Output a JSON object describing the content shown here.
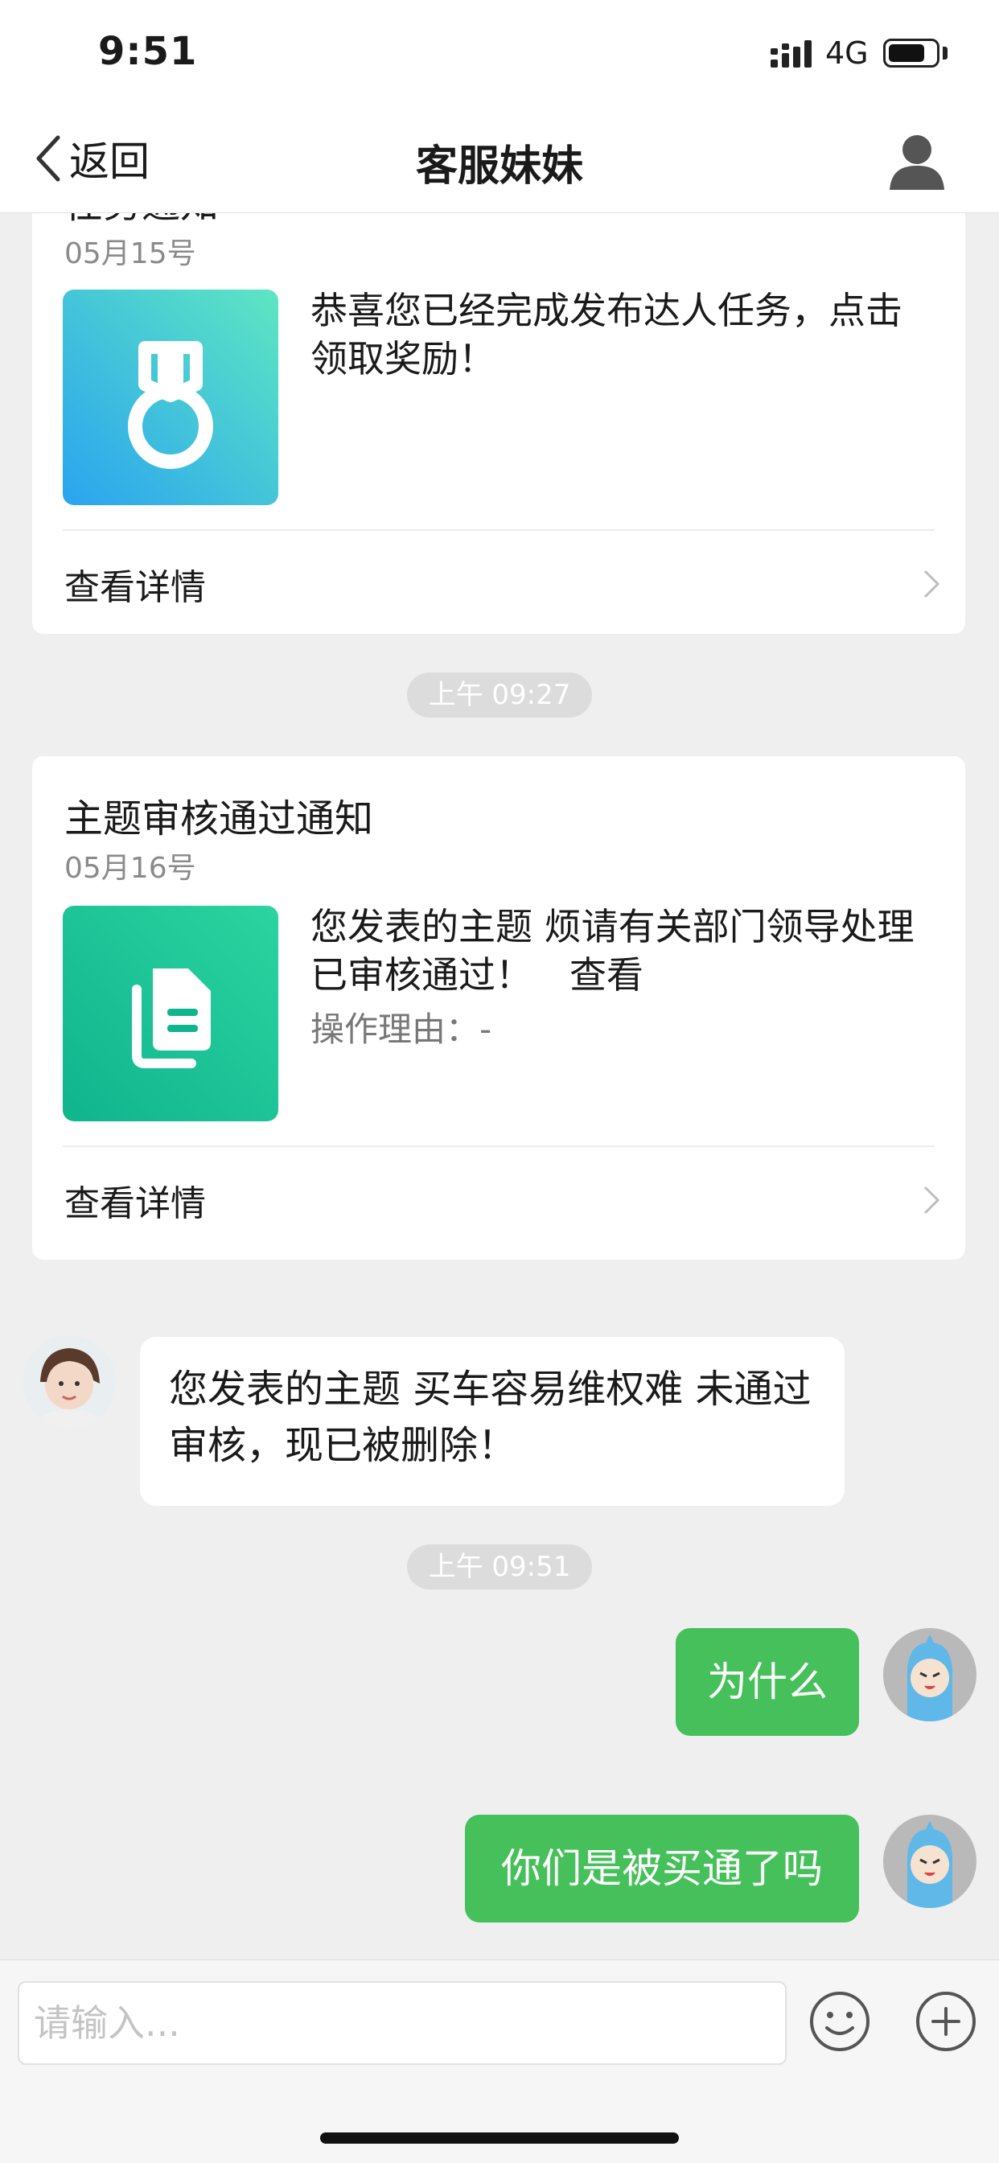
{
  "status_bar": {
    "time": "9:51",
    "network": "4G"
  },
  "nav": {
    "back_label": "返回",
    "title": "客服妹妹"
  },
  "messages": {
    "card1": {
      "title": "任务通知",
      "date": "05月15号",
      "text": "恭喜您已经完成发布达人任务，点击领取奖励！",
      "detail_label": "查看详情",
      "gradient": [
        "#5ee6c2",
        "#2aa4f0"
      ]
    },
    "time1": "上午 09:27",
    "card2": {
      "title": "主题审核通过通知",
      "date": "05月16号",
      "text": "您发表的主题 烦请有关部门领导处理 已审核通过！　查看",
      "reason": "操作理由：-",
      "detail_label": "查看详情",
      "gradient": [
        "#2bd4a0",
        "#10b48d"
      ]
    },
    "incoming": "您发表的主题 买车容易维权难 未通过审核，现已被删除！",
    "time2": "上午 09:51",
    "outgoing1": "为什么",
    "outgoing2": "你们是被买通了吗"
  },
  "input": {
    "placeholder": "请输入..."
  },
  "colors": {
    "bubble_out": "#46c05a",
    "background": "#efeff0"
  }
}
